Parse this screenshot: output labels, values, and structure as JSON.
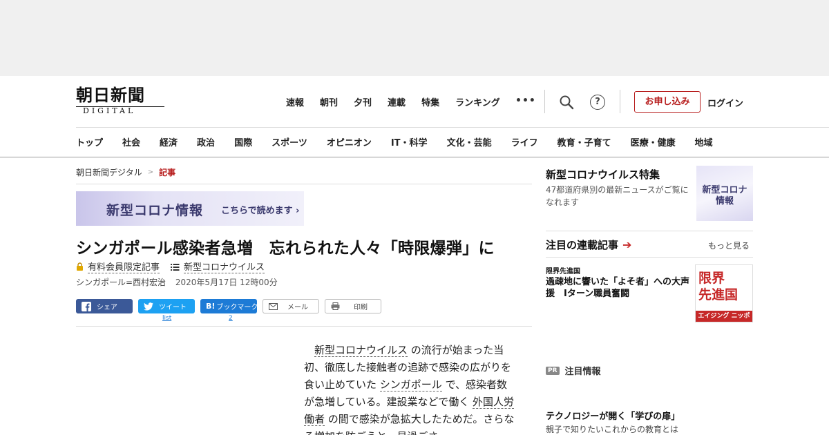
{
  "header": {
    "logo_main": "朝日新聞",
    "logo_sub": "DIGITAL",
    "top_nav": [
      "速報",
      "朝刊",
      "夕刊",
      "連載",
      "特集",
      "ランキング"
    ],
    "apply_button": "お申し込み",
    "login_link": "ログイン",
    "help_glyph": "?",
    "more_glyph": "•••"
  },
  "main_nav": [
    "トップ",
    "社会",
    "経済",
    "政治",
    "国際",
    "スポーツ",
    "オピニオン",
    "IT・科学",
    "文化・芸能",
    "ライフ",
    "教育・子育て",
    "医療・健康",
    "地域"
  ],
  "breadcrumb": {
    "home": "朝日新聞デジタル",
    "current": "記事",
    "sep": ">"
  },
  "corona_banner": {
    "title": "新型コロナ情報",
    "link": "こちらで読めます ›"
  },
  "article": {
    "headline": "シンガポール感染者急増　忘れられた人々「時限爆弾」に",
    "members_only": "有料会員限定記事",
    "topic": "新型コロナウイルス",
    "byline": "シンガポール=西村宏治",
    "date": "2020年5月17日 12時00分",
    "share": {
      "facebook": "シェア",
      "twitter": "ツイート",
      "hatena": "ブックマーク",
      "hatena_glyph": "B!",
      "mail": "メール",
      "print": "印刷",
      "twitter_count": "list",
      "hatena_count": "2"
    },
    "body": {
      "kw1": "新型コロナウイルス",
      "t1": "の流行が始まった当初、徹底した接触者の追跡で感染の広がりを食い止めていた",
      "kw2": "シンガポール",
      "t2": "で、感染者数が急増している。建設業などで働く",
      "kw3": "外国人労働者",
      "t3": "の間で感染が急拡大したためだ。さらなる増加を防ごうと、見過ごさ"
    }
  },
  "sidebar": {
    "feature_title": "新型コロナウイルス特集",
    "feature_desc": "47都道府県別の最新ニュースがご覧になれます",
    "feature_thumb": "新型コロナ\n情報",
    "serial_heading": "注目の連載記事",
    "serial_arrow": "➔",
    "serial_more": "もっと見る",
    "serial_series": "限界先進国",
    "serial_title": "過疎地に響いた「よそ者」への大声援　Iターン職員奮闘",
    "serial_thumb_line1": "限界",
    "serial_thumb_line2": "先進国",
    "serial_thumb_band": "エイジング ニッポン",
    "pr_badge": "PR",
    "pr_heading": "注目情報",
    "ad_title": "テクノロジーが開く「学びの扉」",
    "ad_desc": "親子で知りたいこれからの教育とは"
  },
  "colors": {
    "accent": "#b71c1c",
    "facebook": "#3b5998",
    "twitter": "#1da1f2",
    "hatena": "#1d7bd6",
    "corona": "#3b3a6e"
  }
}
